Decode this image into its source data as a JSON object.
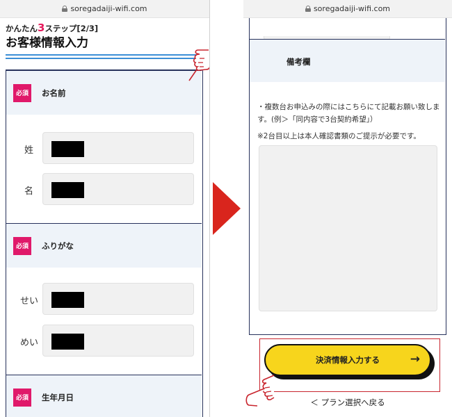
{
  "left": {
    "url": "soregadaiji-wifi.com",
    "step_prefix": "かんたん",
    "step_number": "3",
    "step_suffix": "ステップ[2/3]",
    "page_title": "お客様情報入力",
    "sections": [
      {
        "required": "必須",
        "label": "お名前",
        "fields": [
          "姓",
          "名"
        ]
      },
      {
        "required": "必須",
        "label": "ふりがな",
        "fields": [
          "せい",
          "めい"
        ]
      },
      {
        "required": "必須",
        "label": "生年月日"
      }
    ]
  },
  "right": {
    "url": "soregadaiji-wifi.com",
    "memo_label": "備考欄",
    "note_line1": "・複数台お申込みの際にはこちらにて記載お願い致します。(例＞「同内容で3台契約希望」）",
    "note_line2": "※2台目以上は本人確認書類のご提示が必要です。",
    "pay_button": "決済情報入力する",
    "pay_button_arrow": "→",
    "back_link": "＜ プラン選択へ戻る"
  },
  "colors": {
    "required_badge": "#e0196a",
    "accent_number": "#e6195b",
    "primary_button": "#f7d51c",
    "arrow_red": "#d9251d",
    "section_bg": "#eef3f9",
    "border_navy": "#25305a"
  },
  "icons": [
    "lock-icon",
    "pointing-hand-icon",
    "next-step-arrow-icon",
    "right-arrow-icon"
  ]
}
